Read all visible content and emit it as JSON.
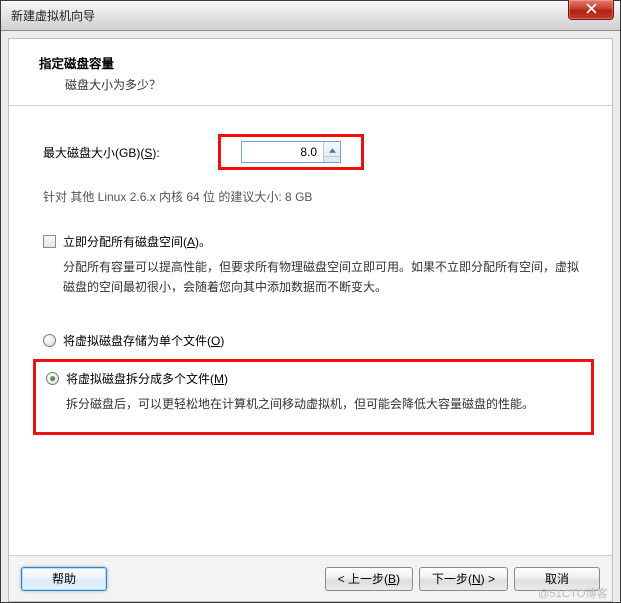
{
  "window": {
    "title": "新建虚拟机向导"
  },
  "header": {
    "title": "指定磁盘容量",
    "subtitle": "磁盘大小为多少？"
  },
  "disk_size": {
    "label_prefix": "最大磁盘大小(GB)(",
    "label_accel": "S",
    "label_suffix": "):",
    "value": "8.0"
  },
  "recommend": "针对 其他 Linux 2.6.x 内核 64 位 的建议大小: 8 GB",
  "allocate_now": {
    "label_prefix": "立即分配所有磁盘空间(",
    "label_accel": "A",
    "label_suffix": ")。",
    "desc": "分配所有容量可以提高性能，但要求所有物理磁盘空间立即可用。如果不立即分配所有空间，虚拟磁盘的空间最初很小，会随着您向其中添加数据而不断变大。"
  },
  "single_file": {
    "label_prefix": "将虚拟磁盘存储为单个文件(",
    "label_accel": "O",
    "label_suffix": ")"
  },
  "split_files": {
    "label_prefix": "将虚拟磁盘拆分成多个文件(",
    "label_accel": "M",
    "label_suffix": ")",
    "desc": "拆分磁盘后，可以更轻松地在计算机之间移动虚拟机，但可能会降低大容量磁盘的性能。"
  },
  "buttons": {
    "help": "帮助",
    "back_prefix": "< 上一步(",
    "back_accel": "B",
    "back_suffix": ")",
    "next_prefix": "下一步(",
    "next_accel": "N",
    "next_suffix": ") >",
    "cancel": "取消"
  },
  "watermark": "@51CTO博客"
}
